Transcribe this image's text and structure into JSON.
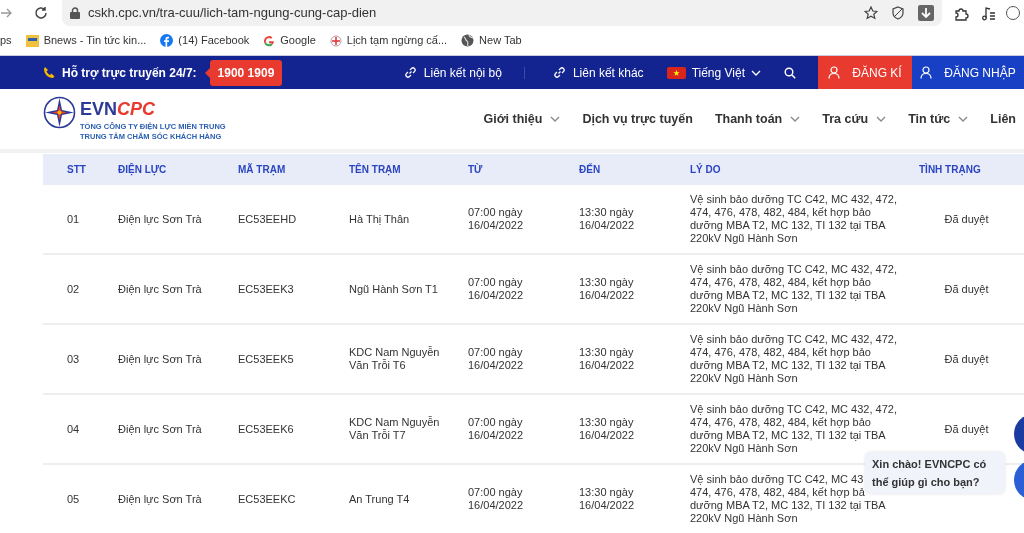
{
  "browser": {
    "url": "cskh.cpc.vn/tra-cuu/lich-tam-ngung-cung-cap-dien",
    "bookmarks": [
      {
        "label": "ps",
        "kind": "plain"
      },
      {
        "label": "Bnews - Tin tức kin...",
        "kind": "news"
      },
      {
        "label": "(14) Facebook",
        "kind": "facebook"
      },
      {
        "label": "Google",
        "kind": "google"
      },
      {
        "label": "Lịch tạm ngừng cấ...",
        "kind": "plus"
      },
      {
        "label": "New Tab",
        "kind": "globe"
      }
    ]
  },
  "topbar": {
    "hotline_label": "Hỗ trợ trực truyến 24/7:",
    "hotline": "1900 1909",
    "links": [
      "Liên kết nội bộ",
      "Liên kết khác"
    ],
    "language": "Tiếng Việt",
    "register": "ĐĂNG KÍ",
    "login": "ĐĂNG NHẬP"
  },
  "header": {
    "logo": {
      "brand_a": "EVN",
      "brand_b": "CPC",
      "line1": "TỔNG CÔNG TY ĐIỆN LỰC MIỀN TRUNG",
      "line2": "TRUNG TÂM CHĂM SÓC KHÁCH HÀNG"
    },
    "nav": [
      {
        "label": "Giới thiệu",
        "has_menu": true
      },
      {
        "label": "Dịch vụ trực tuyến",
        "has_menu": false
      },
      {
        "label": "Thanh toán",
        "has_menu": true
      },
      {
        "label": "Tra cứu",
        "has_menu": true
      },
      {
        "label": "Tin tức",
        "has_menu": true
      },
      {
        "label": "Liên",
        "has_menu": false
      }
    ]
  },
  "table": {
    "columns": [
      "STT",
      "ĐIỆN LỰC",
      "MÃ TRẠM",
      "TÊN TRẠM",
      "TỪ",
      "ĐẾN",
      "LÝ DO",
      "TÌNH TRẠNG"
    ],
    "rows": [
      [
        "01",
        "Điện lực Sơn Trà",
        "EC53EEHD",
        "Hà Thị Thân",
        "07:00 ngày 16/04/2022",
        "13:30 ngày 16/04/2022",
        "Vệ sinh bảo dưỡng TC C42, MC 432, 472, 474, 476, 478, 482, 484, kết hợp bảo dưỡng MBA T2, MC 132, TI 132 tại TBA 220kV Ngũ Hành Sơn",
        "Đã duyệt"
      ],
      [
        "02",
        "Điện lực Sơn Trà",
        "EC53EEK3",
        "Ngũ Hành Sơn T1",
        "07:00 ngày 16/04/2022",
        "13:30 ngày 16/04/2022",
        "Vệ sinh bảo dưỡng TC C42, MC 432, 472, 474, 476, 478, 482, 484, kết hợp bảo dưỡng MBA T2, MC 132, TI 132 tại TBA 220kV Ngũ Hành Sơn",
        "Đã duyệt"
      ],
      [
        "03",
        "Điện lực Sơn Trà",
        "EC53EEK5",
        "KDC Nam Nguyễn Văn Trỗi T6",
        "07:00 ngày 16/04/2022",
        "13:30 ngày 16/04/2022",
        "Vệ sinh bảo dưỡng TC C42, MC 432, 472, 474, 476, 478, 482, 484, kết hợp bảo dưỡng MBA T2, MC 132, TI 132 tại TBA 220kV Ngũ Hành Sơn",
        "Đã duyệt"
      ],
      [
        "04",
        "Điện lực Sơn Trà",
        "EC53EEK6",
        "KDC Nam Nguyễn Văn Trỗi T7",
        "07:00 ngày 16/04/2022",
        "13:30 ngày 16/04/2022",
        "Vệ sinh bảo dưỡng TC C42, MC 432, 472, 474, 476, 478, 482, 484, kết hợp bảo dưỡng MBA T2, MC 132, TI 132 tại TBA 220kV Ngũ Hành Sơn",
        "Đã duyệt"
      ],
      [
        "05",
        "Điện lực Sơn Trà",
        "EC53EEKC",
        "An Trung T4",
        "07:00 ngày 16/04/2022",
        "13:30 ngày 16/04/2022",
        [
          "Vệ sinh bảo dưỡng TC C42, MC 43",
          "474, 476, 478, 482, 484, kết hợp bả",
          "dưỡng MBA T2, MC 132, TI 132 tại TBA",
          "220kV Ngũ Hành Sơn"
        ]
      ]
    ]
  },
  "chat_bubble": "Xin chào! EVNCPC có thể giúp gì cho bạn?"
}
